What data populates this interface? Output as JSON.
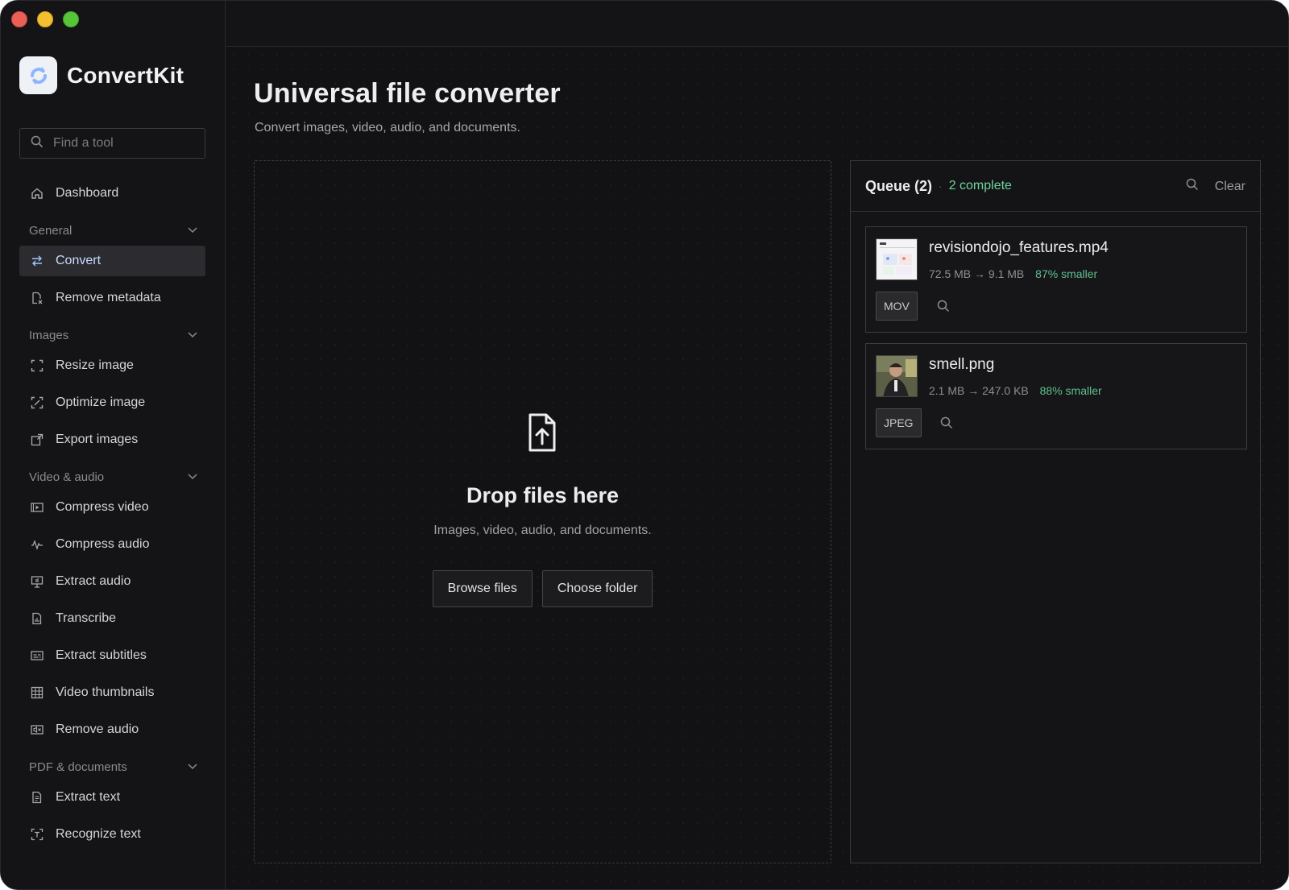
{
  "app": {
    "name": "ConvertKit"
  },
  "sidebar": {
    "search_placeholder": "Find a tool",
    "dashboard": "Dashboard",
    "sections": {
      "general": "General",
      "images": "Images",
      "video_audio": "Video & audio",
      "pdf_documents": "PDF & documents"
    },
    "items": {
      "convert": "Convert",
      "remove_metadata": "Remove metadata",
      "resize_image": "Resize image",
      "optimize_image": "Optimize image",
      "export_images": "Export images",
      "compress_video": "Compress video",
      "compress_audio": "Compress audio",
      "extract_audio": "Extract audio",
      "transcribe": "Transcribe",
      "extract_subtitles": "Extract subtitles",
      "video_thumbnails": "Video thumbnails",
      "remove_audio": "Remove audio",
      "extract_text": "Extract text",
      "recognize_text": "Recognize text"
    },
    "active": "convert"
  },
  "main": {
    "title": "Universal file converter",
    "subtitle": "Convert images, video, audio, and documents.",
    "dropzone": {
      "title": "Drop files here",
      "subtitle": "Images, video, audio, and documents.",
      "browse_label": "Browse files",
      "folder_label": "Choose folder"
    }
  },
  "queue": {
    "title": "Queue (2)",
    "complete": "2 complete",
    "clear_label": "Clear",
    "files": [
      {
        "name": "revisiondojo_features.mp4",
        "size_from": "72.5 MB",
        "arrow": "→",
        "size_to": "9.1 MB",
        "saving": "87% smaller",
        "format": "MOV"
      },
      {
        "name": "smell.png",
        "size_from": "2.1 MB",
        "arrow": "→",
        "size_to": "247.0 KB",
        "saving": "88% smaller",
        "format": "JPEG"
      }
    ]
  },
  "colors": {
    "accent": "#a7c4ff",
    "success": "#6fd2a0",
    "background": "#121214"
  }
}
